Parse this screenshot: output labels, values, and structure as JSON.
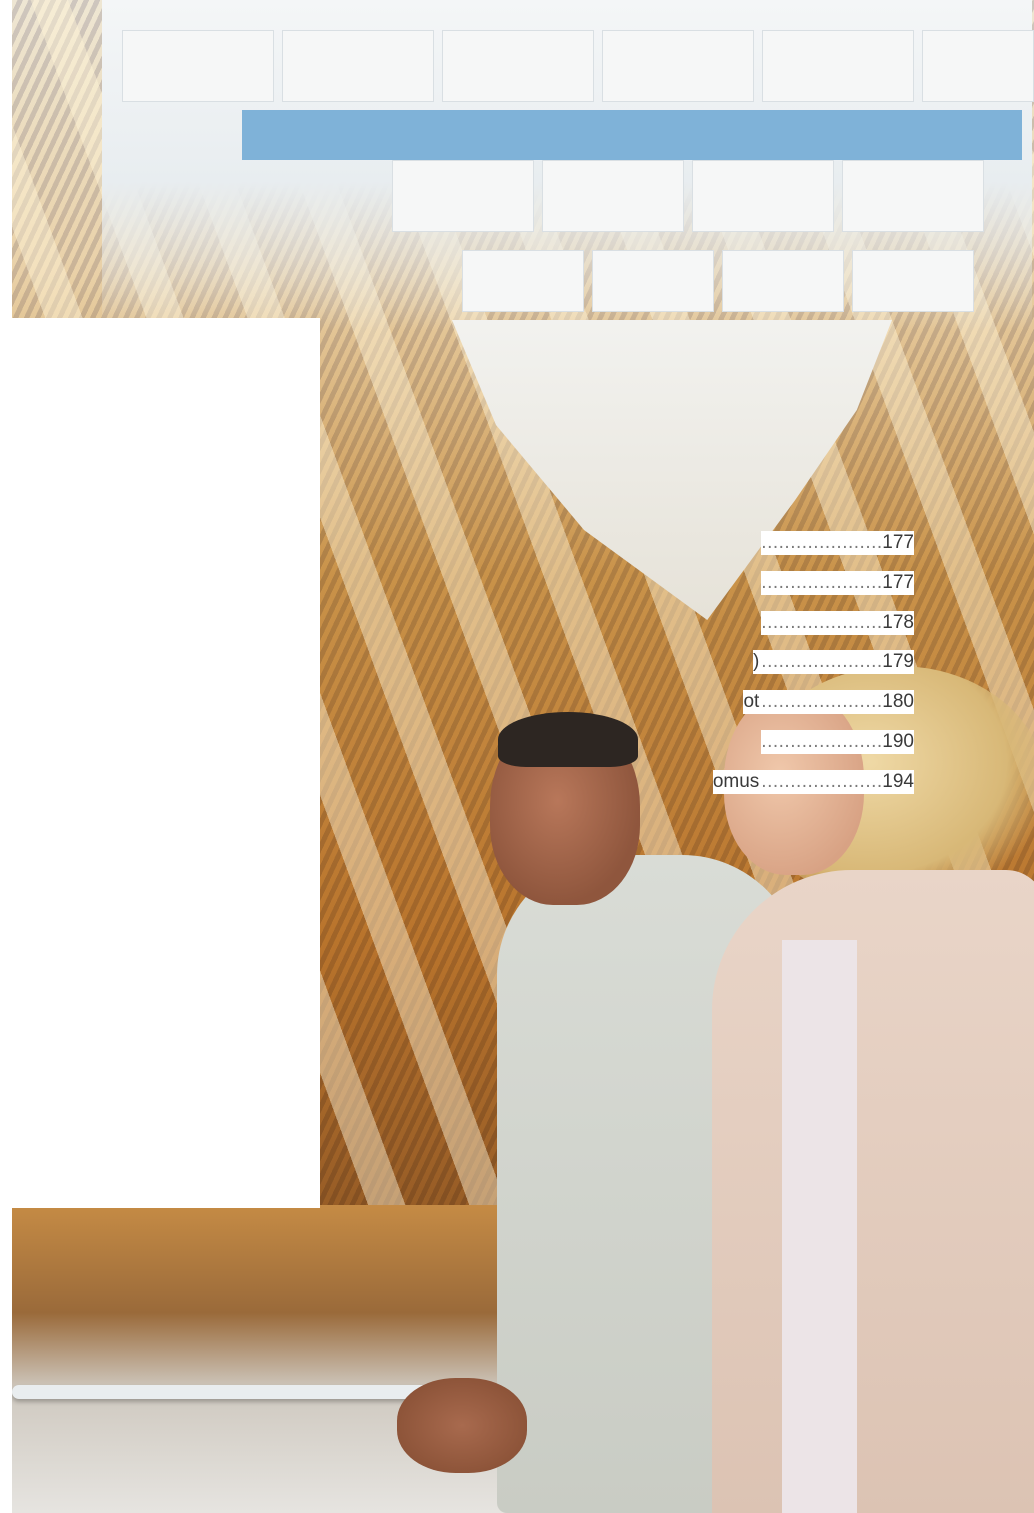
{
  "toc": {
    "entries": [
      {
        "text": "",
        "page": "177"
      },
      {
        "text": "",
        "page": "177"
      },
      {
        "text": "",
        "page": "178"
      },
      {
        "text": ")",
        "page": "179"
      },
      {
        "text": "ot",
        "page": "180"
      },
      {
        "text": "",
        "page": "190"
      },
      {
        "text": "omus",
        "page": "194"
      }
    ],
    "leader": "..............................................................."
  },
  "photo": {
    "subject": "two-people-under-wooden-ceiling"
  }
}
